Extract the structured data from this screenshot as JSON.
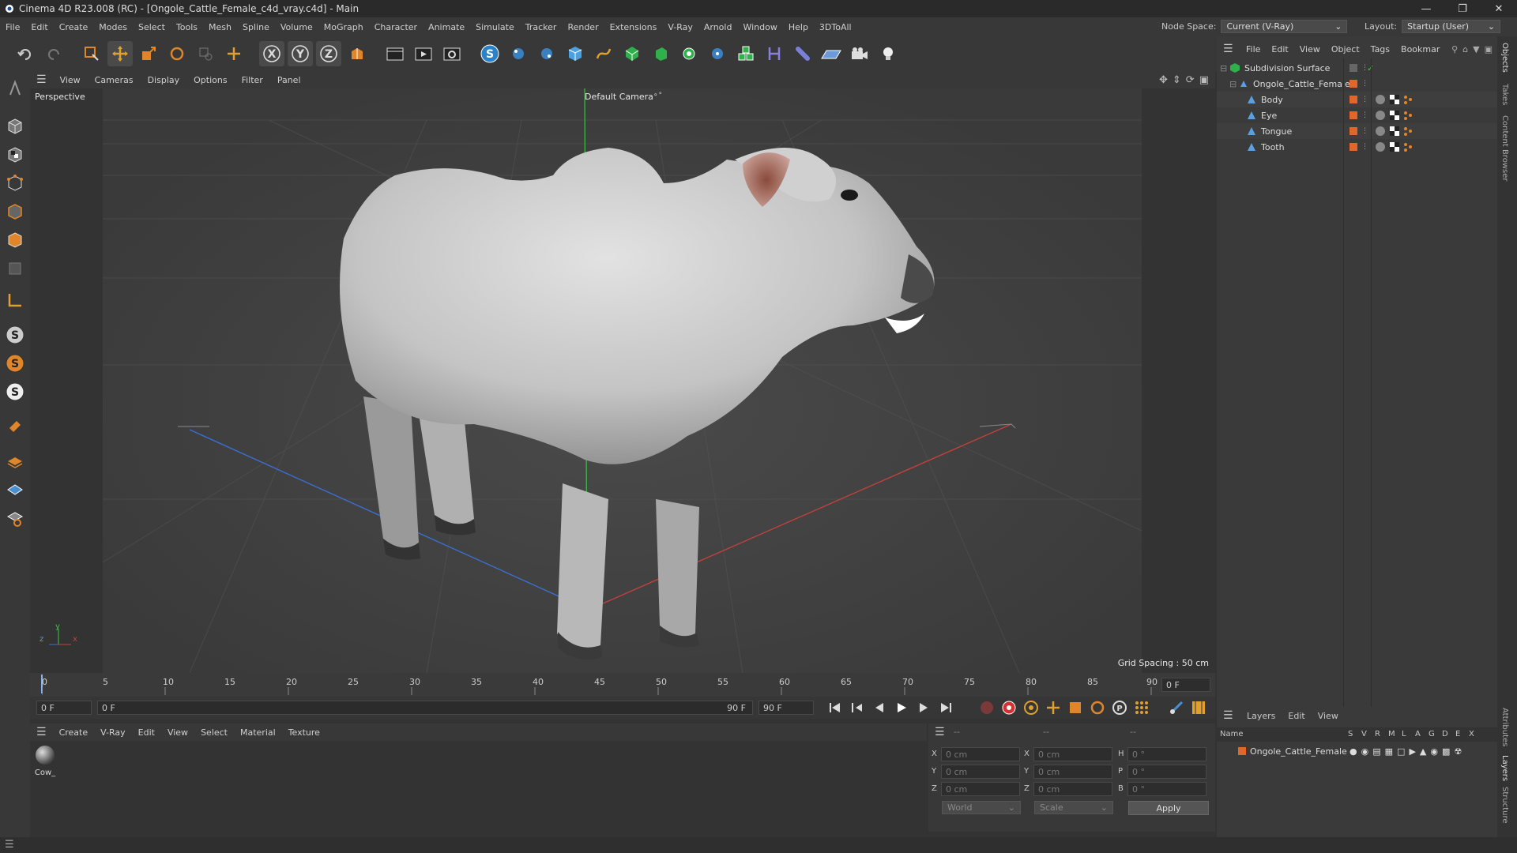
{
  "window": {
    "title": "Cinema 4D R23.008 (RC) - [Ongole_Cattle_Female_c4d_vray.c4d] - Main"
  },
  "menu": [
    "File",
    "Edit",
    "Create",
    "Modes",
    "Select",
    "Tools",
    "Mesh",
    "Spline",
    "Volume",
    "MoGraph",
    "Character",
    "Animate",
    "Simulate",
    "Tracker",
    "Render",
    "Extensions",
    "V-Ray",
    "Arnold",
    "Window",
    "Help",
    "3DToAll"
  ],
  "node_space": {
    "label": "Node Space:",
    "value": "Current (V-Ray)"
  },
  "layout": {
    "label": "Layout:",
    "value": "Startup (User)"
  },
  "viewport": {
    "menu": [
      "View",
      "Cameras",
      "Display",
      "Options",
      "Filter",
      "Panel"
    ],
    "perspective": "Perspective",
    "camera": "Default Camera",
    "camera_glyph": "⚬°",
    "grid_spacing": "Grid Spacing : 50 cm",
    "axis_y": "y",
    "axis_x": "x",
    "axis_z": "z"
  },
  "timeline": {
    "ticks": [
      "0",
      "5",
      "10",
      "15",
      "20",
      "25",
      "30",
      "35",
      "40",
      "45",
      "50",
      "55",
      "60",
      "65",
      "70",
      "75",
      "80",
      "85",
      "90"
    ],
    "current_frame": "0 F"
  },
  "playbar": {
    "start": "0 F",
    "range_start": "0 F",
    "range_end": "90 F",
    "end": "90 F"
  },
  "material_menu": [
    "Create",
    "V-Ray",
    "Edit",
    "View",
    "Select",
    "Material",
    "Texture"
  ],
  "material": {
    "name": "Cow_"
  },
  "coords": {
    "dash": "--",
    "x_label": "X",
    "y_label": "Y",
    "z_label": "Z",
    "h_label": "H",
    "p_label": "P",
    "b_label": "B",
    "pos_x": "0 cm",
    "pos_y": "0 cm",
    "pos_z": "0 cm",
    "size_x": "0 cm",
    "size_y": "0 cm",
    "size_z": "0 cm",
    "rot_h": "0 °",
    "rot_p": "0 °",
    "rot_b": "0 °",
    "mode1": "World",
    "mode2": "Scale",
    "apply": "Apply"
  },
  "objects": {
    "menu": [
      "File",
      "Edit",
      "View",
      "Object",
      "Tags",
      "Bookmar"
    ],
    "items": [
      {
        "name": "Subdivision Surface"
      },
      {
        "name": "Ongole_Cattle_Female"
      },
      {
        "name": "Body"
      },
      {
        "name": "Eye"
      },
      {
        "name": "Tongue"
      },
      {
        "name": "Tooth"
      }
    ]
  },
  "layers": {
    "menu": [
      "Layers",
      "Edit",
      "View"
    ],
    "header": {
      "name": "Name",
      "cols": [
        "S",
        "V",
        "R",
        "M",
        "L",
        "A",
        "G",
        "D",
        "E",
        "X"
      ]
    },
    "items": [
      {
        "name": "Ongole_Cattle_Female"
      }
    ]
  },
  "side_tabs": [
    "Objects",
    "Takes",
    "Content Browser",
    "Attributes",
    "Layers",
    "Structure"
  ],
  "colors": {
    "accent": "#e0662a",
    "x_axis": "#c0413c",
    "z_axis": "#3a6fd0",
    "y_axis": "#3fc048"
  }
}
